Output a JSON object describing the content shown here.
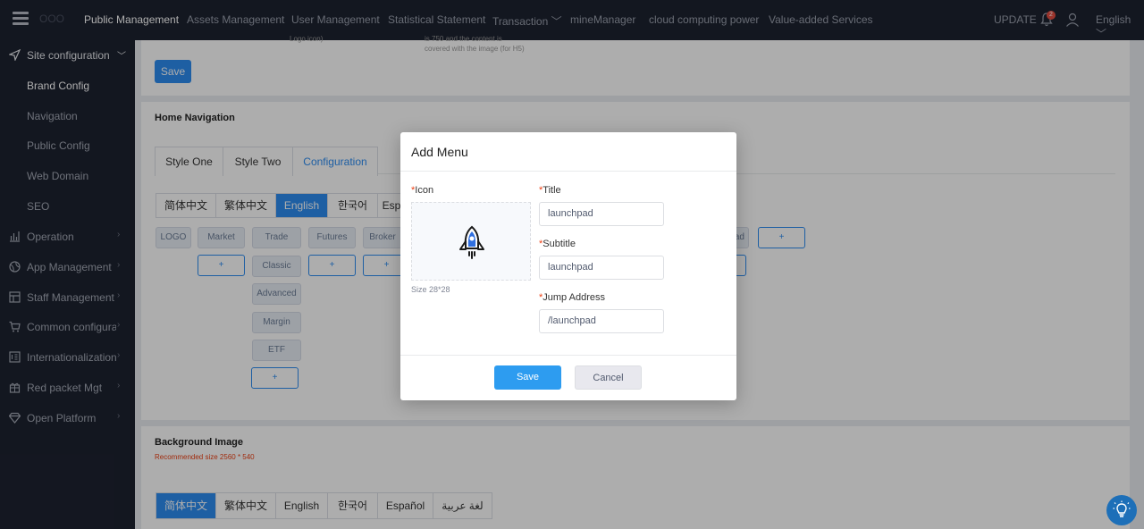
{
  "brand": {
    "logo_text": "ООО"
  },
  "topnav": {
    "items": [
      "Public Management",
      "Assets Management",
      "User Management",
      "Statistical Statement",
      "Transaction",
      "mineManager",
      "cloud computing power",
      "Value-added Services"
    ],
    "update": "UPDATE",
    "notifications": "2",
    "language": "English"
  },
  "sidebar": {
    "section": "Site configuration",
    "subitems": [
      "Brand Config",
      "Navigation",
      "Public Config",
      "Web Domain",
      "SEO"
    ],
    "groups": [
      "Operation",
      "App Management",
      "Staff Management",
      "Common configura...",
      "Internationalization...",
      "Red packet Mgt",
      "Open Platform"
    ]
  },
  "top_card": {
    "hint_left": "Logo icon)",
    "hint_right_1": "is 750 and the content is",
    "hint_right_2": "covered with the image (for H5)",
    "save": "Save"
  },
  "home_nav": {
    "title": "Home Navigation",
    "style_tabs": [
      "Style One",
      "Style Two",
      "Configuration"
    ],
    "lang_tabs": [
      "简体中文",
      "繁体中文",
      "English",
      "한국어",
      "Esp"
    ],
    "row1": [
      "LOGO",
      "Market",
      "Trade",
      "Futures",
      "Broker"
    ],
    "col_items": [
      "Classic",
      "Advanced",
      "Margin",
      "ETF"
    ],
    "partial_right": "ad",
    "plus": "+"
  },
  "bg_image": {
    "title": "Background Image",
    "note": "Recommended size 2560 * 540",
    "lang_tabs": [
      "简体中文",
      "繁体中文",
      "English",
      "한국어",
      "Español",
      "لغة عربية"
    ]
  },
  "modal": {
    "title": "Add Menu",
    "icon_label": "Icon",
    "size_note": "Size 28*28",
    "title_label": "Title",
    "title_value": "launchpad",
    "subtitle_label": "Subtitle",
    "subtitle_value": "launchpad",
    "jump_label": "Jump Address",
    "jump_value": "/launchpad",
    "save": "Save",
    "cancel": "Cancel",
    "required_mark": "*"
  },
  "colors": {
    "primary": "#2d8cf0",
    "nav_bg": "#1d2230",
    "danger": "#ed4014"
  },
  "icons": [
    "menu-icon",
    "bell-icon",
    "user-icon",
    "send-icon",
    "chart-icon",
    "globe-icon",
    "grid-icon",
    "cart-icon",
    "language-icon",
    "gift-icon",
    "diamond-icon",
    "rocket-icon",
    "lightbulb-icon"
  ]
}
